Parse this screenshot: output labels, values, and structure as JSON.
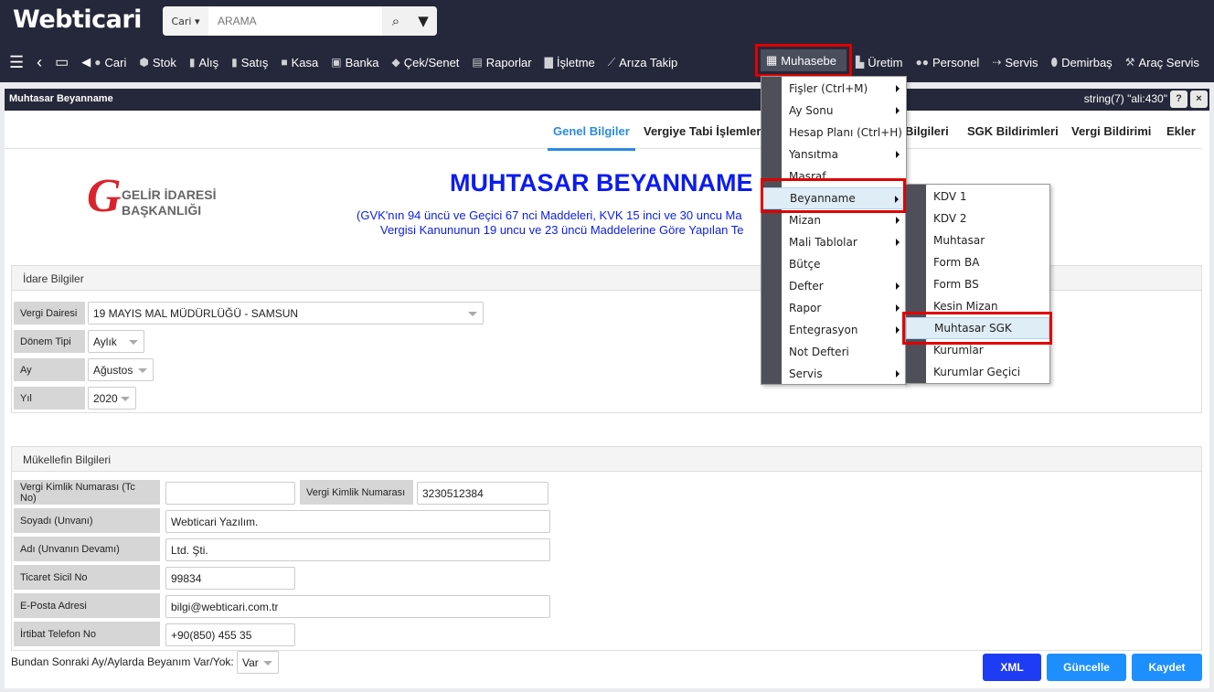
{
  "app": {
    "logo": "Webticari",
    "search_scope": "Cari",
    "search_placeholder": "ARAMA"
  },
  "nav": [
    "Cari",
    "Stok",
    "Alış",
    "Satış",
    "Kasa",
    "Banka",
    "Çek/Senet",
    "Raporlar",
    "İşletme",
    "Arıza Takip",
    "Muhasebe",
    "Üretim",
    "Personel",
    "Servis",
    "Demirbaş",
    "Araç Servis"
  ],
  "window": {
    "title": "Muhtasar Beyanname",
    "debug": "string(7) \"ali:430\"",
    "help": "?",
    "close": "×"
  },
  "tabs": [
    "Genel Bilgiler",
    "Vergiye Tabi İşlemler",
    "Bilgileri",
    "SGK Bildirimleri",
    "Vergi Bildirimi",
    "Ekler"
  ],
  "header": {
    "logo_text": "GELİR İDARESİ BAŞKANLIĞI",
    "title": "MUHTASAR BEYANNAME",
    "sub1": "(GVK'nın 94 üncü ve Geçici 67 nci Maddeleri, KVK 15 inci ve 30 uncu Ma",
    "sub2": "Vergisi Kanununun 19 uncu ve 23 üncü Maddelerine Göre Yapılan Te"
  },
  "idare": {
    "title": "İdare Bilgiler",
    "vergi_dairesi_label": "Vergi Dairesi",
    "vergi_dairesi": "19 MAYIS MAL MÜDÜRLÜĞÜ - SAMSUN",
    "donem_label": "Dönem Tipi",
    "donem": "Aylık",
    "ay_label": "Ay",
    "ay": "Ağustos",
    "yil_label": "Yıl",
    "yil": "2020"
  },
  "mukellef": {
    "title": "Mükellefin Bilgileri",
    "tc_label": "Vergi Kimlik Numarası (Tc No)",
    "tc": "",
    "vkn_label": "Vergi Kimlik Numarası",
    "vkn": "3230512384",
    "soyadi_label": "Soyadı (Unvanı)",
    "soyadi": "Webticari Yazılım.",
    "adi_label": "Adı (Unvanın Devamı)",
    "adi": "Ltd. Şti.",
    "sicil_label": "Ticaret Sicil No",
    "sicil": "99834",
    "eposta_label": "E-Posta Adresi",
    "eposta": "bilgi@webticari.com.tr",
    "tel_label": "İrtibat Telefon No",
    "tel": "+90(850) 455 35"
  },
  "footer": {
    "question": "Bundan Sonraki Ay/Aylarda Beyanım Var/Yok:",
    "answer": "Var",
    "xml": "XML",
    "guncelle": "Güncelle",
    "kaydet": "Kaydet"
  },
  "menu": [
    {
      "label": "Fişler (Ctrl+M)",
      "sub": true
    },
    {
      "label": "Ay Sonu",
      "sub": true
    },
    {
      "label": "Hesap Planı (Ctrl+H)",
      "sub": false
    },
    {
      "label": "Yansıtma",
      "sub": true
    },
    {
      "label": "Masraf",
      "sub": false
    },
    {
      "label": "Beyanname",
      "sub": true
    },
    {
      "label": "Mizan",
      "sub": true
    },
    {
      "label": "Mali Tablolar",
      "sub": true
    },
    {
      "label": "Bütçe",
      "sub": false
    },
    {
      "label": "Defter",
      "sub": true
    },
    {
      "label": "Rapor",
      "sub": true
    },
    {
      "label": "Entegrasyon",
      "sub": true
    },
    {
      "label": "Not Defteri",
      "sub": false
    },
    {
      "label": "Servis",
      "sub": true
    }
  ],
  "submenu": [
    "KDV 1",
    "KDV 2",
    "Muhtasar",
    "Form BA",
    "Form BS",
    "Kesin Mizan",
    "Muhtasar SGK",
    "Kurumlar",
    "Kurumlar Geçici"
  ],
  "colors": {
    "topbar": "#25283a",
    "accent": "#2a8be0",
    "title_blue": "#0b1cf0",
    "xml_button": "#1f3cf5",
    "button": "#1e8fff",
    "highlight": "#e00000"
  }
}
